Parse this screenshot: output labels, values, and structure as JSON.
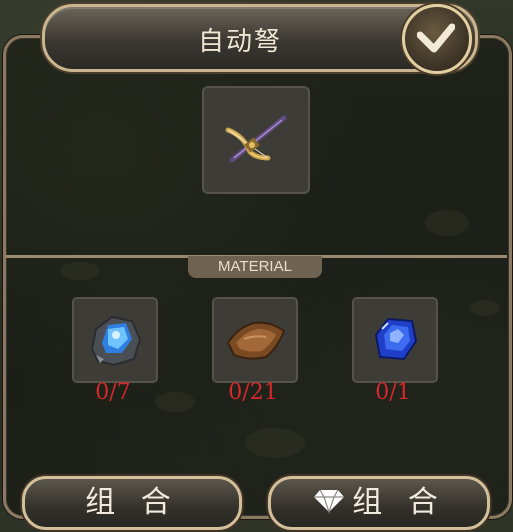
{
  "title": "自动弩",
  "confirm_icon": "checkmark-icon",
  "result_item": {
    "icon": "crossbow-icon"
  },
  "material_label": "MATERIAL",
  "materials": [
    {
      "icon": "blue-ore-icon",
      "count": "0/7"
    },
    {
      "icon": "leather-hide-icon",
      "count": "0/21"
    },
    {
      "icon": "sapphire-gem-icon",
      "count": "0/1"
    }
  ],
  "buttons": {
    "combine": "组 合",
    "gem_combine": "组 合",
    "gem_combine_icon": "diamond-icon"
  },
  "colors": {
    "count_red": "#d6282c",
    "frame_gold": "#cbb58f"
  }
}
